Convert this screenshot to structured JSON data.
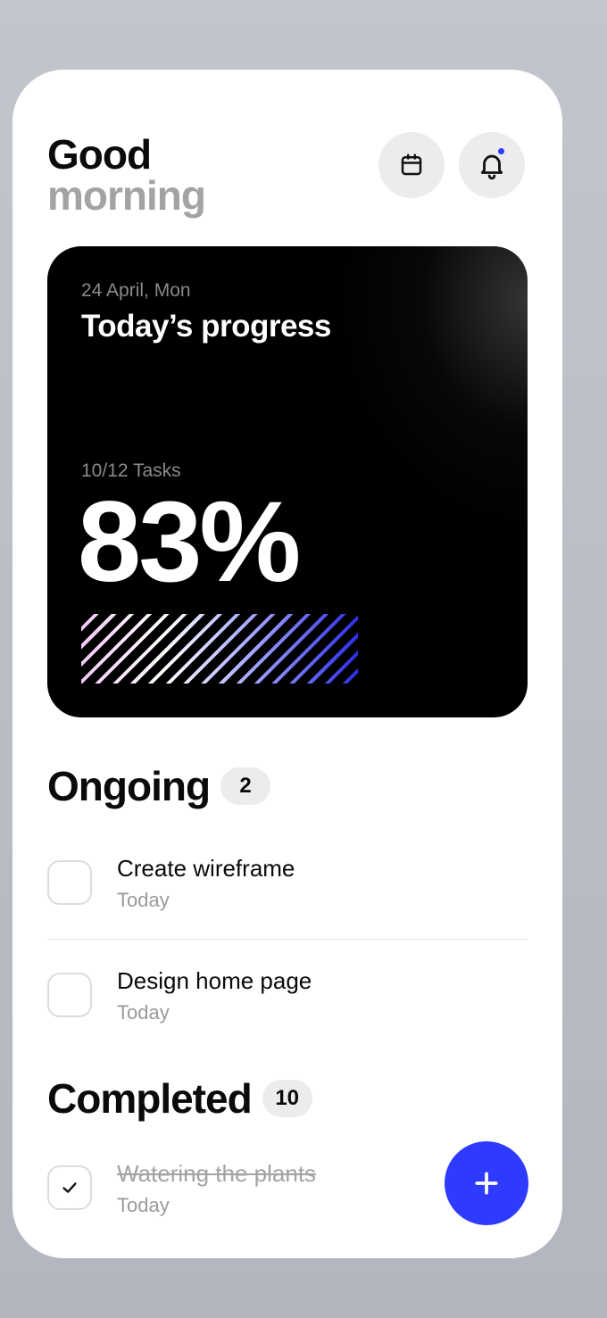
{
  "header": {
    "greeting_line1": "Good",
    "greeting_line2": "morning",
    "calendar_icon": "calendar-icon",
    "bell_icon": "bell-icon",
    "has_notification": true
  },
  "progress_card": {
    "date": "24 April, Mon",
    "title": "Today’s progress",
    "tasks_label": "10/12 Tasks",
    "percent_label": "83%",
    "progress_fraction": 0.83
  },
  "ongoing": {
    "title": "Ongoing",
    "count": "2",
    "tasks": [
      {
        "title": "Create wireframe",
        "date": "Today",
        "done": false
      },
      {
        "title": "Design home page",
        "date": "Today",
        "done": false
      }
    ]
  },
  "completed": {
    "title": "Completed",
    "count": "10",
    "tasks": [
      {
        "title": "Watering the plants",
        "date": "Today",
        "done": true
      }
    ]
  },
  "fab": {
    "icon": "plus-icon"
  },
  "colors": {
    "accent": "#2e3bff",
    "card_background": "#000000",
    "muted_text": "#a3a3a3",
    "badge_background": "#ececec"
  }
}
